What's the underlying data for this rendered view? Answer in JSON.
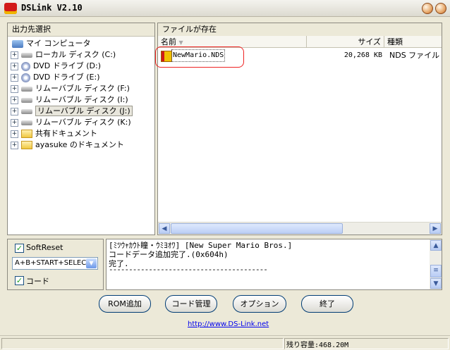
{
  "window": {
    "title": "DSLink V2.10"
  },
  "left_pane": {
    "header": "出力先選択",
    "tree": [
      {
        "label": "マイ コンピュータ",
        "icon": "computer-icon",
        "expander": false
      },
      {
        "label": "ローカル ディスク (C:)",
        "icon": "hard-drive-icon",
        "expander": true
      },
      {
        "label": "DVD ドライブ (D:)",
        "icon": "dvd-drive-icon",
        "expander": true
      },
      {
        "label": "DVD ドライブ (E:)",
        "icon": "dvd-drive-icon",
        "expander": true
      },
      {
        "label": "リムーバブル ディスク (F:)",
        "icon": "removable-disk-icon",
        "expander": true
      },
      {
        "label": "リムーバブル ディスク (I:)",
        "icon": "removable-disk-icon",
        "expander": true
      },
      {
        "label": "リムーバブル ディスク (J:)",
        "icon": "removable-disk-icon",
        "expander": true,
        "selected": true
      },
      {
        "label": "リムーバブル ディスク (K:)",
        "icon": "removable-disk-icon",
        "expander": true
      },
      {
        "label": "共有ドキュメント",
        "icon": "folder-icon",
        "expander": true
      },
      {
        "label": "ayasuke のドキュメント",
        "icon": "folder-icon",
        "expander": true
      }
    ]
  },
  "right_pane": {
    "header": "ファイルが存在",
    "columns": {
      "name": "名前",
      "size": "サイズ",
      "type": "種類"
    },
    "files": [
      {
        "name": "NewMario.NDS",
        "size": "20,268 KB",
        "type": "NDS ファイル"
      }
    ]
  },
  "options": {
    "softreset_label": "SoftReset",
    "softreset_checked": true,
    "combo_value": "A+B+START+SELECT",
    "code_label": "コード",
    "code_checked": true
  },
  "log": {
    "lines": [
      "[ﾐﾂｳｬｶｳﾄ瞳・ｳﾐﾖｵﾜ] [New Super Mario Bros.]",
      "コードデータ追加完了.(0x604h)",
      "完了.",
      "----------------------------------------"
    ]
  },
  "buttons": {
    "add_rom": "ROM追加",
    "code_manage": "コード管理",
    "options": "オプション",
    "exit": "終了"
  },
  "link": "http://www.DS-Link.net",
  "status": {
    "remaining": "残り容量:468.20M"
  },
  "colors": {
    "highlight": "#ee2222",
    "link": "#0000ee",
    "check": "#21a121"
  }
}
